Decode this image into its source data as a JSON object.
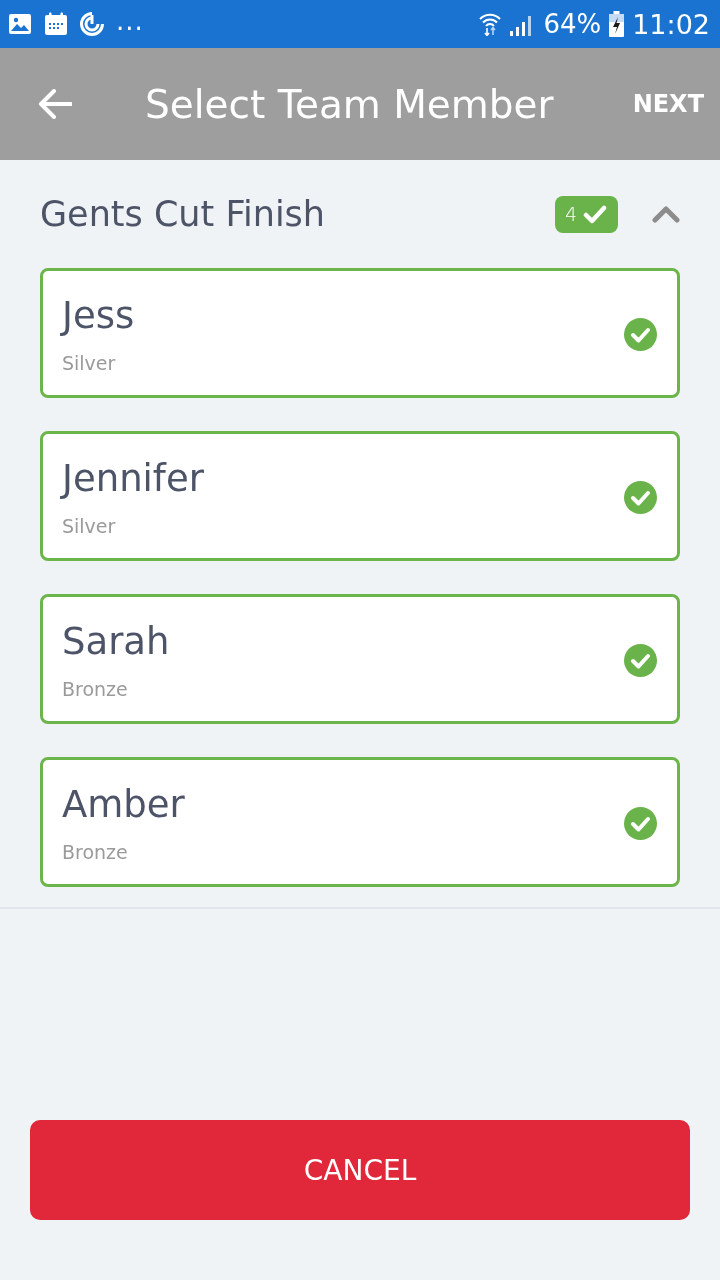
{
  "status_bar": {
    "overflow": "...",
    "battery": "64%",
    "time": "11:02"
  },
  "app_bar": {
    "title": "Select Team Member",
    "action": "NEXT"
  },
  "section": {
    "title": "Gents Cut Finish",
    "count": "4",
    "expanded": true
  },
  "members": [
    {
      "name": "Jess",
      "tier": "Silver",
      "selected": true
    },
    {
      "name": "Jennifer",
      "tier": "Silver",
      "selected": true
    },
    {
      "name": "Sarah",
      "tier": "Bronze",
      "selected": true
    },
    {
      "name": "Amber",
      "tier": "Bronze",
      "selected": true
    }
  ],
  "cancel": "CANCEL"
}
